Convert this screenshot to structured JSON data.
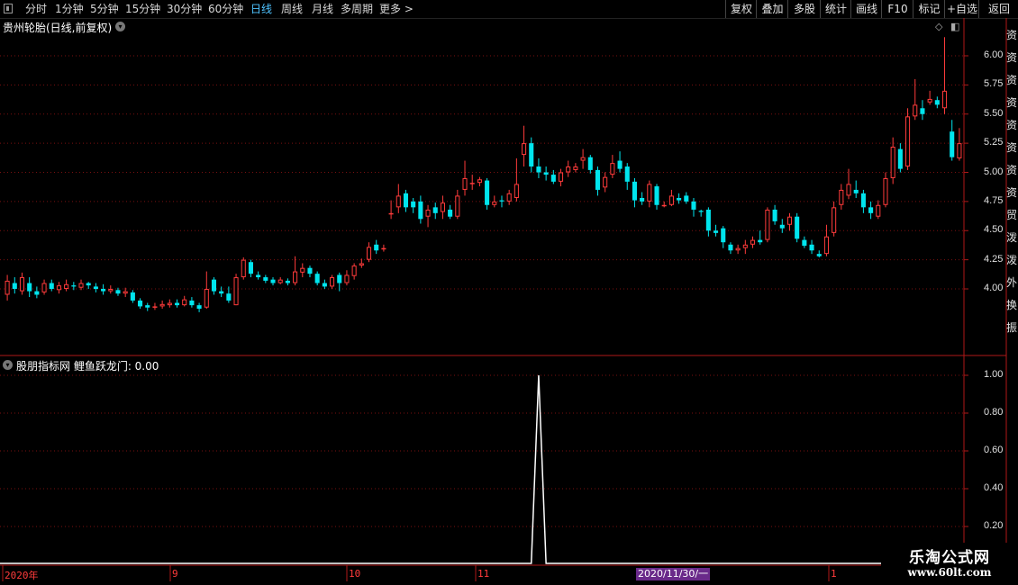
{
  "toolbar": {
    "periods": [
      "分时",
      "1分钟",
      "5分钟",
      "15分钟",
      "30分钟",
      "60分钟",
      "日线",
      "周线",
      "月线",
      "多周期",
      "更多 >"
    ],
    "active_period": "日线",
    "right_buttons": [
      "复权",
      "叠加",
      "多股",
      "统计",
      "画线",
      "F10",
      "标记",
      "+自选",
      "返回"
    ]
  },
  "main_chart": {
    "title": "贵州轮胎(日线,前复权)",
    "y_ticks": [
      "6.00",
      "5.75",
      "5.50",
      "5.25",
      "5.00",
      "4.75",
      "4.50",
      "4.25",
      "4.00"
    ]
  },
  "indicator": {
    "title": "股朋指标网 鲤鱼跃龙门: 0.00",
    "y_ticks": [
      "1.00",
      "0.80",
      "0.60",
      "0.40",
      "0.20"
    ]
  },
  "x_axis": {
    "labels": [
      "2020年",
      "9",
      "10",
      "11",
      "1"
    ],
    "highlight": "2020/11/30/一"
  },
  "watermark": {
    "main": "乐淘公式网",
    "sub": "www.60lt.com"
  },
  "right_strip_text": [
    "资",
    "资",
    "资",
    "资",
    "资",
    "资",
    "资",
    "资",
    "贸",
    "泼",
    "泼",
    "外",
    "换",
    "振"
  ],
  "colors": {
    "up": "#ff3b3b",
    "down": "#00e5ee",
    "grid": "#7a1010",
    "axis": "#b01818",
    "active": "#4fc3ff"
  },
  "chart_data": {
    "type": "candlestick",
    "ylim": [
      3.7,
      6.2
    ],
    "candles": [
      [
        3.95,
        4.07,
        4.12,
        3.9
      ],
      [
        4.05,
        4.0,
        4.1,
        3.96
      ],
      [
        3.98,
        4.1,
        4.14,
        3.95
      ],
      [
        4.05,
        3.98,
        4.1,
        3.93
      ],
      [
        3.98,
        3.95,
        4.02,
        3.92
      ],
      [
        3.97,
        4.05,
        4.08,
        3.95
      ],
      [
        4.05,
        4.0,
        4.08,
        3.98
      ],
      [
        3.99,
        4.03,
        4.06,
        3.96
      ],
      [
        4.0,
        4.04,
        4.08,
        3.98
      ],
      [
        4.03,
        4.02,
        4.06,
        3.99
      ],
      [
        4.01,
        4.05,
        4.08,
        3.99
      ],
      [
        4.05,
        4.03,
        4.06,
        4.0
      ],
      [
        4.02,
        4.0,
        4.05,
        3.97
      ],
      [
        4.0,
        3.98,
        4.04,
        3.95
      ],
      [
        3.98,
        4.0,
        4.03,
        3.96
      ],
      [
        3.99,
        3.96,
        4.01,
        3.94
      ],
      [
        3.96,
        3.98,
        4.01,
        3.93
      ],
      [
        3.97,
        3.9,
        3.99,
        3.88
      ],
      [
        3.9,
        3.85,
        3.92,
        3.83
      ],
      [
        3.86,
        3.84,
        3.88,
        3.81
      ],
      [
        3.84,
        3.85,
        3.88,
        3.82
      ],
      [
        3.85,
        3.87,
        3.9,
        3.83
      ],
      [
        3.86,
        3.88,
        3.91,
        3.84
      ],
      [
        3.88,
        3.86,
        3.91,
        3.84
      ],
      [
        3.86,
        3.91,
        3.94,
        3.85
      ],
      [
        3.9,
        3.86,
        3.93,
        3.84
      ],
      [
        3.86,
        3.83,
        3.88,
        3.8
      ],
      [
        3.84,
        4.0,
        4.15,
        3.83
      ],
      [
        4.08,
        3.98,
        4.1,
        3.95
      ],
      [
        3.98,
        3.96,
        4.02,
        3.93
      ],
      [
        3.96,
        3.9,
        4.02,
        3.88
      ],
      [
        3.86,
        4.1,
        4.13,
        3.86
      ],
      [
        4.1,
        4.25,
        4.27,
        4.08
      ],
      [
        4.23,
        4.13,
        4.25,
        4.1
      ],
      [
        4.12,
        4.1,
        4.15,
        4.08
      ],
      [
        4.1,
        4.07,
        4.12,
        4.05
      ],
      [
        4.08,
        4.05,
        4.1,
        4.03
      ],
      [
        4.05,
        4.08,
        4.1,
        4.04
      ],
      [
        4.07,
        4.05,
        4.09,
        4.03
      ],
      [
        4.05,
        4.15,
        4.28,
        4.03
      ],
      [
        4.14,
        4.18,
        4.22,
        4.1
      ],
      [
        4.18,
        4.13,
        4.2,
        4.1
      ],
      [
        4.13,
        4.05,
        4.15,
        4.03
      ],
      [
        4.05,
        4.02,
        4.08,
        4.0
      ],
      [
        4.02,
        4.1,
        4.12,
        4.0
      ],
      [
        4.12,
        4.05,
        4.14,
        3.98
      ],
      [
        4.05,
        4.12,
        4.16,
        4.03
      ],
      [
        4.11,
        4.2,
        4.22,
        4.08
      ],
      [
        4.2,
        4.22,
        4.26,
        4.18
      ],
      [
        4.25,
        4.36,
        4.4,
        4.23
      ],
      [
        4.38,
        4.33,
        4.42,
        4.3
      ],
      [
        4.35,
        4.35,
        4.38,
        4.32
      ],
      [
        4.65,
        4.65,
        4.76,
        4.6
      ],
      [
        4.7,
        4.8,
        4.9,
        4.65
      ],
      [
        4.82,
        4.7,
        4.85,
        4.66
      ],
      [
        4.75,
        4.7,
        4.78,
        4.65
      ],
      [
        4.75,
        4.6,
        4.8,
        4.56
      ],
      [
        4.62,
        4.68,
        4.72,
        4.53
      ],
      [
        4.7,
        4.65,
        4.74,
        4.6
      ],
      [
        4.66,
        4.74,
        4.8,
        4.6
      ],
      [
        4.68,
        4.62,
        4.72,
        4.6
      ],
      [
        4.62,
        4.8,
        4.85,
        4.6
      ],
      [
        4.85,
        4.95,
        5.1,
        4.8
      ],
      [
        4.9,
        4.91,
        4.98,
        4.85
      ],
      [
        4.91,
        4.94,
        4.96,
        4.88
      ],
      [
        4.93,
        4.72,
        4.95,
        4.68
      ],
      [
        4.72,
        4.75,
        4.8,
        4.7
      ],
      [
        4.76,
        4.75,
        4.8,
        4.7
      ],
      [
        4.75,
        4.82,
        4.85,
        4.72
      ],
      [
        4.78,
        4.9,
        5.12,
        4.75
      ],
      [
        5.15,
        5.25,
        5.4,
        5.05
      ],
      [
        5.25,
        5.05,
        5.3,
        5.0
      ],
      [
        5.05,
        5.0,
        5.12,
        4.95
      ],
      [
        5.0,
        4.98,
        5.05,
        4.93
      ],
      [
        4.98,
        4.92,
        5.02,
        4.9
      ],
      [
        4.92,
        5.0,
        5.03,
        4.88
      ],
      [
        5.0,
        5.05,
        5.1,
        4.96
      ],
      [
        5.02,
        5.05,
        5.08,
        5.0
      ],
      [
        5.1,
        5.13,
        5.2,
        5.03
      ],
      [
        5.13,
        5.02,
        5.15,
        4.99
      ],
      [
        5.02,
        4.85,
        5.05,
        4.8
      ],
      [
        4.87,
        4.96,
        5.0,
        4.83
      ],
      [
        4.98,
        5.08,
        5.15,
        4.95
      ],
      [
        5.1,
        5.03,
        5.18,
        5.0
      ],
      [
        5.05,
        4.92,
        5.08,
        4.85
      ],
      [
        4.92,
        4.76,
        4.95,
        4.7
      ],
      [
        4.78,
        4.75,
        4.83,
        4.72
      ],
      [
        4.75,
        4.9,
        4.93,
        4.7
      ],
      [
        4.88,
        4.72,
        4.9,
        4.68
      ],
      [
        4.72,
        4.72,
        4.75,
        4.7
      ],
      [
        4.72,
        4.8,
        4.85,
        4.71
      ],
      [
        4.78,
        4.76,
        4.82,
        4.73
      ],
      [
        4.8,
        4.75,
        4.83,
        4.73
      ],
      [
        4.75,
        4.68,
        4.78,
        4.62
      ],
      [
        4.67,
        4.66,
        4.68,
        4.62
      ],
      [
        4.68,
        4.5,
        4.7,
        4.45
      ],
      [
        4.5,
        4.48,
        4.55,
        4.45
      ],
      [
        4.52,
        4.4,
        4.54,
        4.35
      ],
      [
        4.38,
        4.33,
        4.4,
        4.3
      ],
      [
        4.33,
        4.35,
        4.38,
        4.3
      ],
      [
        4.35,
        4.38,
        4.42,
        4.3
      ],
      [
        4.38,
        4.42,
        4.45,
        4.35
      ],
      [
        4.42,
        4.4,
        4.5,
        4.38
      ],
      [
        4.42,
        4.68,
        4.7,
        4.4
      ],
      [
        4.68,
        4.58,
        4.72,
        4.55
      ],
      [
        4.55,
        4.52,
        4.6,
        4.48
      ],
      [
        4.55,
        4.62,
        4.65,
        4.5
      ],
      [
        4.62,
        4.43,
        4.65,
        4.4
      ],
      [
        4.42,
        4.37,
        4.45,
        4.35
      ],
      [
        4.38,
        4.33,
        4.42,
        4.3
      ],
      [
        4.3,
        4.28,
        4.33,
        4.27
      ],
      [
        4.3,
        4.45,
        4.55,
        4.28
      ],
      [
        4.48,
        4.7,
        4.75,
        4.45
      ],
      [
        4.72,
        4.85,
        4.9,
        4.68
      ],
      [
        4.8,
        4.9,
        5.03,
        4.77
      ],
      [
        4.85,
        4.82,
        4.93,
        4.78
      ],
      [
        4.82,
        4.7,
        4.85,
        4.65
      ],
      [
        4.7,
        4.65,
        4.75,
        4.6
      ],
      [
        4.62,
        4.72,
        4.76,
        4.6
      ],
      [
        4.72,
        4.95,
        5.0,
        4.7
      ],
      [
        4.95,
        5.22,
        5.3,
        4.9
      ],
      [
        5.2,
        5.03,
        5.25,
        5.0
      ],
      [
        5.05,
        5.48,
        5.55,
        5.02
      ],
      [
        5.48,
        5.58,
        5.8,
        5.45
      ],
      [
        5.55,
        5.5,
        5.62,
        5.45
      ],
      [
        5.6,
        5.63,
        5.7,
        5.58
      ],
      [
        5.62,
        5.58,
        5.65,
        5.55
      ],
      [
        5.55,
        5.7,
        6.16,
        5.5
      ],
      [
        5.35,
        5.13,
        5.45,
        5.1
      ],
      [
        5.12,
        5.25,
        5.38,
        5.1
      ]
    ],
    "indicator_series": {
      "name": "鲤鱼跃龙门",
      "ylim": [
        0,
        1.05
      ],
      "spike_index": 72,
      "spike_value": 1.0
    }
  }
}
